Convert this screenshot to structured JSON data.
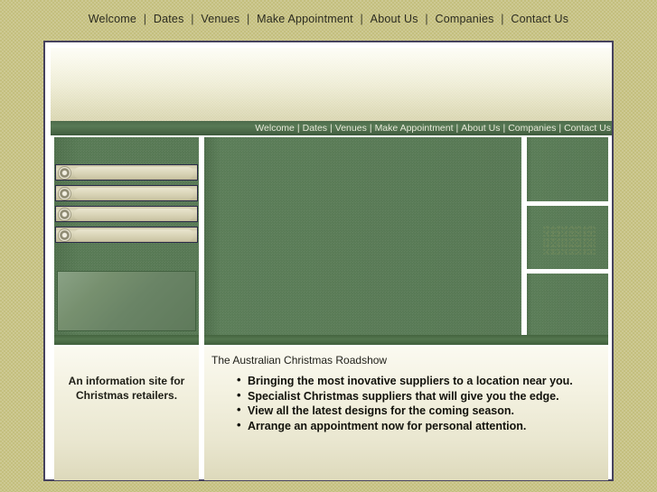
{
  "site": {
    "title": "The Australian Christmas Roadshow"
  },
  "top_nav": {
    "separator": "|",
    "items": [
      {
        "label": "Welcome"
      },
      {
        "label": "Dates"
      },
      {
        "label": "Venues"
      },
      {
        "label": "Make Appointment"
      },
      {
        "label": "About Us"
      },
      {
        "label": "Companies"
      },
      {
        "label": "Contact Us"
      }
    ]
  },
  "inner_nav": {
    "separator": "|",
    "items": [
      {
        "label": "Welcome"
      },
      {
        "label": "Dates"
      },
      {
        "label": "Venues"
      },
      {
        "label": "Make Appointment"
      },
      {
        "label": "About Us"
      },
      {
        "label": "Companies"
      },
      {
        "label": "Contact Us"
      }
    ]
  },
  "sidebar": {
    "buttons": [
      {
        "icon": "radio-circle-icon",
        "label": ""
      },
      {
        "icon": "radio-circle-icon",
        "label": ""
      },
      {
        "icon": "radio-circle-icon",
        "label": ""
      },
      {
        "icon": "radio-circle-icon",
        "label": ""
      }
    ]
  },
  "bottom_left": {
    "blurb_line_1": "An information site for",
    "blurb_line_2": "Christmas retailers."
  },
  "bottom_right": {
    "headline": "The Australian Christmas Roadshow",
    "bullets": [
      "Bringing the most inovative suppliers to a location near you.",
      "Specialist Christmas suppliers that will give you the edge.",
      "View all the latest designs for the coming season.",
      "Arrange an appointment now for personal attention."
    ]
  },
  "colors": {
    "page_background": "#c4bf7e",
    "panel_green": "#577854",
    "nav_green": "#4d6b4b",
    "border_purple": "#46425e",
    "cream": "#f2f0de",
    "button_beige": "#dcd7bb"
  }
}
